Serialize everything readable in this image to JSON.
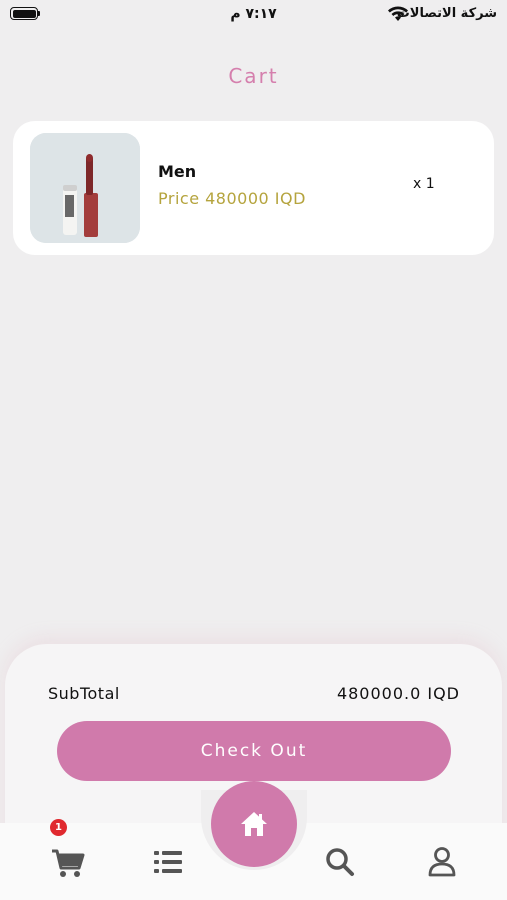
{
  "status_bar": {
    "carrier": "شركة الاتصالات",
    "time": "٧:١٧ م"
  },
  "header": {
    "title": "Cart"
  },
  "cart": {
    "items": [
      {
        "name": "Men",
        "price": "Price 480000 IQD",
        "quantity": "x 1",
        "image_icon": "lipstick-product-image"
      }
    ]
  },
  "summary": {
    "subtotal_label": "SubTotal",
    "subtotal_value": "480000.0 IQD",
    "checkout_label": "Check Out"
  },
  "bottom_nav": {
    "cart_badge": "1",
    "items": [
      {
        "icon": "cart-icon"
      },
      {
        "icon": "list-icon"
      },
      {
        "icon": "home-icon"
      },
      {
        "icon": "search-icon"
      },
      {
        "icon": "profile-icon"
      }
    ]
  },
  "colors": {
    "accent": "#d07aab",
    "title": "#d57fad",
    "price": "#b5a43e",
    "badge": "#e0292f",
    "background": "#efeeef"
  }
}
